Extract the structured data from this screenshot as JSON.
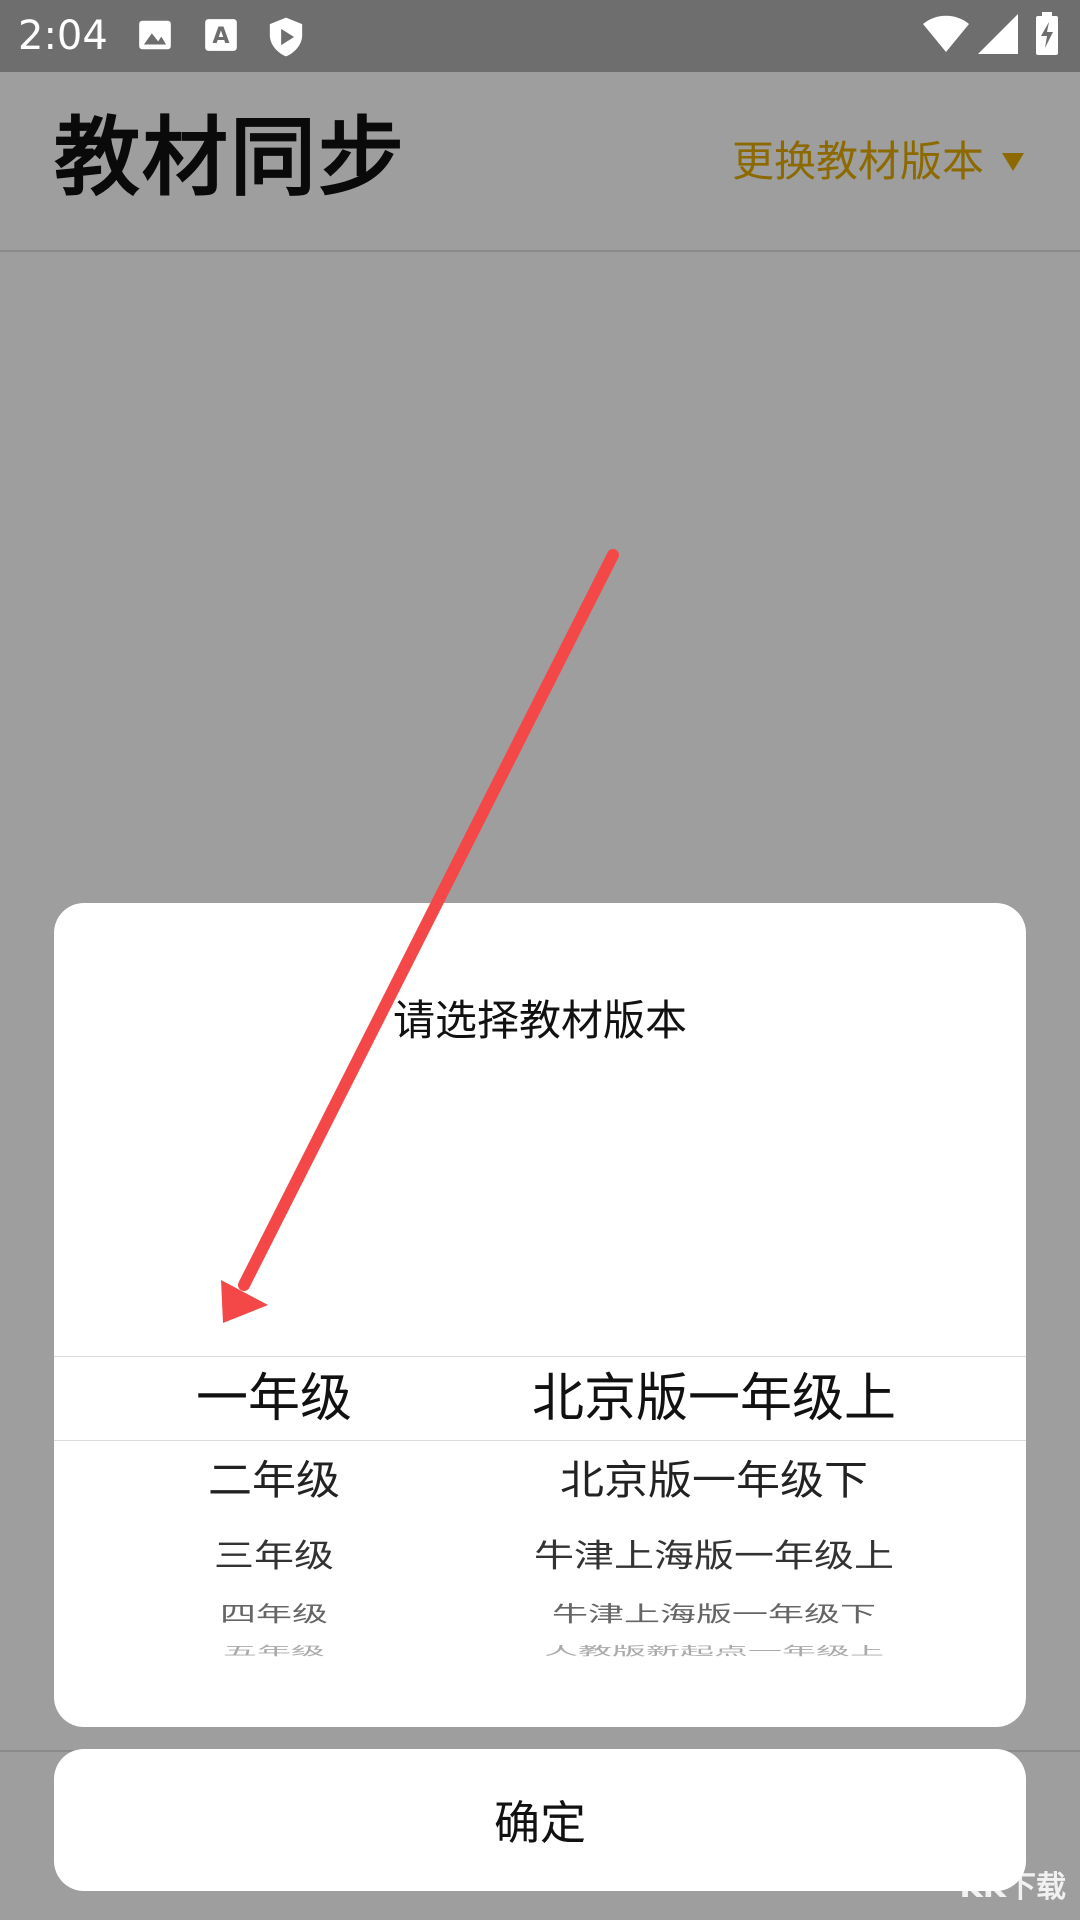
{
  "status_bar": {
    "time": "2:04",
    "icons": [
      "image-icon",
      "text-a-icon",
      "shield-play-icon",
      "wifi-icon",
      "signal-icon",
      "battery-icon"
    ]
  },
  "header": {
    "title": "教材同步",
    "change_version_label": "更换教材版本",
    "accent_color": "#8c6a00"
  },
  "dialog": {
    "title": "请选择教材版本",
    "grades": [
      "一年级",
      "二年级",
      "三年级",
      "四年级",
      "五年级"
    ],
    "versions": [
      "北京版一年级上",
      "北京版一年级下",
      "牛津上海版一年级上",
      "牛津上海版一年级下",
      "人教版新起点一年级上"
    ],
    "selected_grade": "一年级",
    "selected_version": "北京版一年级上"
  },
  "confirm_label": "确定",
  "watermark": "KK下载"
}
